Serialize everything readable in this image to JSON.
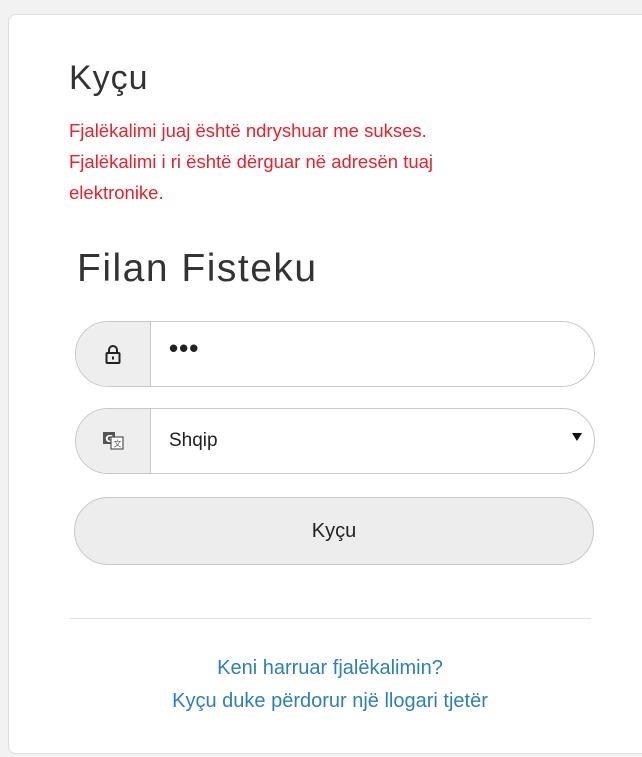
{
  "login": {
    "title": "Kyçu",
    "message_lines": [
      "Fjalëkalimi juaj është ndryshuar me sukses.",
      "Fjalëkalimi i ri është dërguar në adresën tuaj",
      "elektronike."
    ],
    "username": "Filan Fisteku",
    "password_value": "•••",
    "language": {
      "selected": "Shqip"
    },
    "submit_label": "Kyçu",
    "links": {
      "forgot_password": "Keni harruar fjalëkalimin?",
      "other_account": "Kyçu duke përdorur një llogari tjetër"
    }
  },
  "icons": {
    "password_addon": "lock-icon",
    "language_addon": "translate-icon",
    "select_arrow": "caret-down-icon"
  },
  "colors": {
    "error_text": "#e8212d",
    "link": "#2d7fb8",
    "text": "#333333",
    "border": "#c8c8c8",
    "addon_bg": "#eeeeee"
  }
}
